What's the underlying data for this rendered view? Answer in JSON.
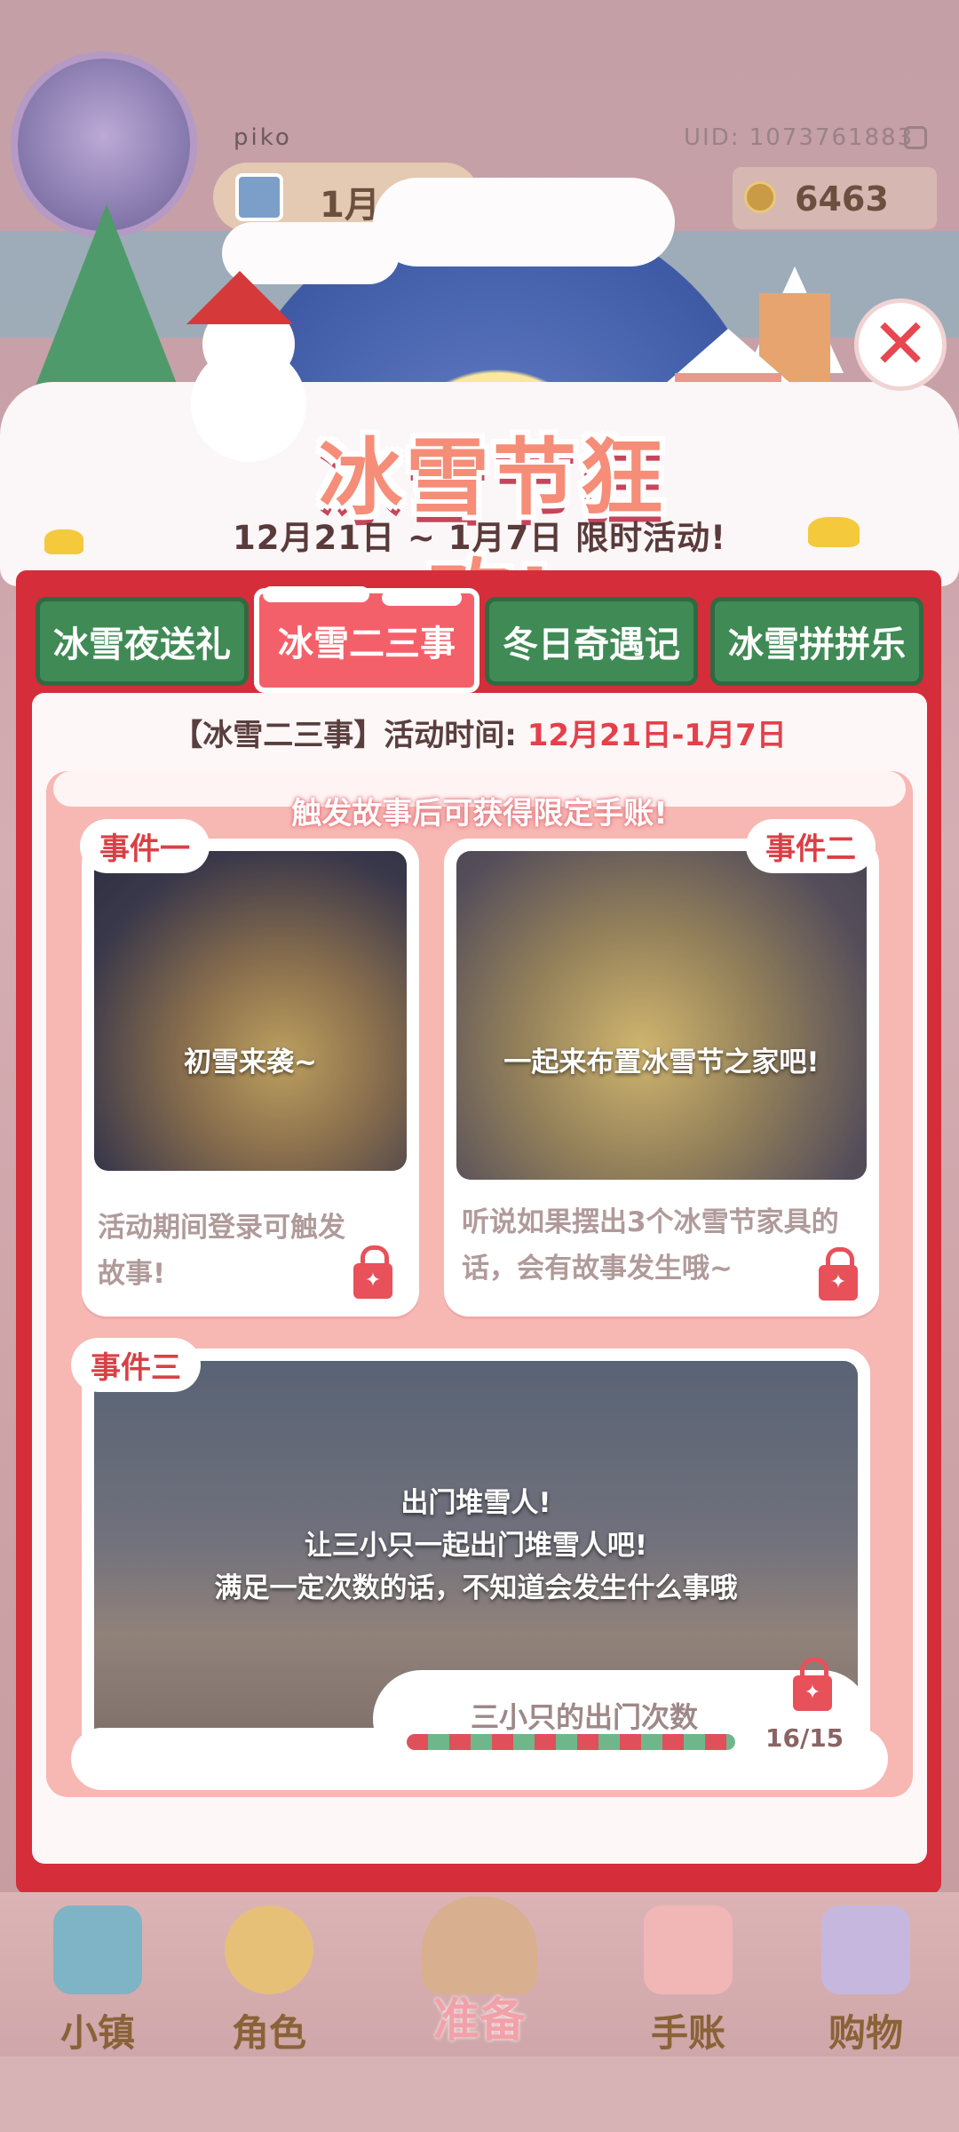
{
  "hud": {
    "username": "piko",
    "uid": "UID: 1073761883",
    "date": "1月6",
    "coins": "6463"
  },
  "banner": {
    "title": "冰雪节狂欢!",
    "subtitle": "12月21日 ~ 1月7日 限时活动!"
  },
  "tabs": [
    {
      "label": "冰雪夜送礼",
      "active": false
    },
    {
      "label": "冰雪二三事",
      "active": true
    },
    {
      "label": "冬日奇遇记",
      "active": false
    },
    {
      "label": "冰雪拼拼乐",
      "active": false
    }
  ],
  "activity": {
    "name": "【冰雪二三事】",
    "time_label": "活动时间:",
    "time_value": "12月21日-1月7日",
    "notice": "触发故事后可获得限定手账!"
  },
  "events": [
    {
      "tag": "事件一",
      "caption": "初雪来袭~",
      "description": "活动期间登录可触发故事!"
    },
    {
      "tag": "事件二",
      "caption": "一起来布置冰雪节之家吧!",
      "description": "听说如果摆出3个冰雪节家具的话，会有故事发生哦~"
    },
    {
      "tag": "事件三",
      "caption_line1": "出门堆雪人!",
      "caption_line2": "让三小只一起出门堆雪人吧!",
      "caption_line3": "满足一定次数的话，不知道会发生什么事哦",
      "progress_label": "三小只的出门次数",
      "progress_count": "16/15",
      "progress_value": 1.0
    }
  ],
  "nav": {
    "town": "小镇",
    "character": "角色",
    "prepare": "准备",
    "journal": "手账",
    "shop": "购物"
  },
  "colors": {
    "panel_red": "#d52d3a",
    "tab_green": "#3f8a55",
    "tab_active": "#f4606a",
    "accent_red": "#e4404b"
  }
}
